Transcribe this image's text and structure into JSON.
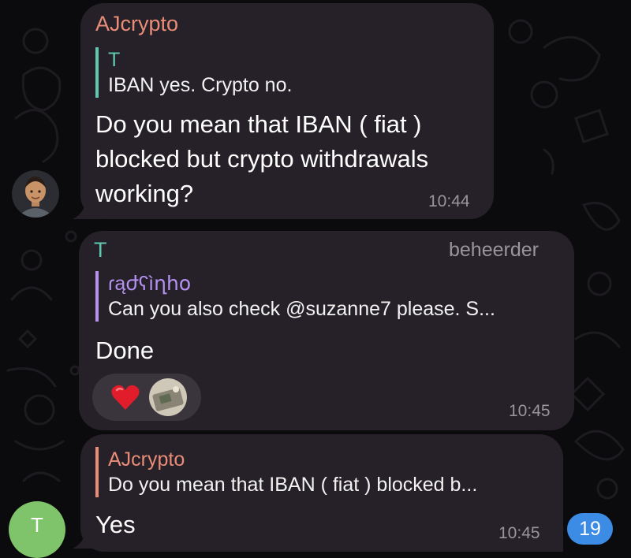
{
  "messages": [
    {
      "sender": "AJcrypto",
      "sender_color": "#e98d78",
      "reply": {
        "name": "T",
        "name_color": "#5ec8b0",
        "text": "IBAN yes. Crypto no."
      },
      "body": [
        "Do you mean that IBAN ( fiat )",
        "blocked but crypto withdrawals",
        "working?"
      ],
      "time": "10:44"
    },
    {
      "sender": "T",
      "sender_color": "#5ec8b0",
      "role": "beheerder",
      "reply": {
        "name": "ɾąժʕìղհօ",
        "name_color": "#b592f2",
        "text": "Can you also check @suzanne7 please. S..."
      },
      "body": [
        "Done"
      ],
      "reactions": [
        "heart-emoji",
        "sticker-avatar"
      ],
      "time": "10:45"
    },
    {
      "reply": {
        "name": "AJcrypto",
        "name_color": "#e98d78",
        "text": "Do you mean that IBAN ( fiat ) blocked b..."
      },
      "body": [
        "Yes"
      ],
      "time": "10:45",
      "avatar_letter": "T",
      "avatar_color": "#7fc46a"
    }
  ],
  "unread_badge": "19",
  "colors": {
    "bubble": "#262128",
    "accent": "#3c8ce6"
  }
}
